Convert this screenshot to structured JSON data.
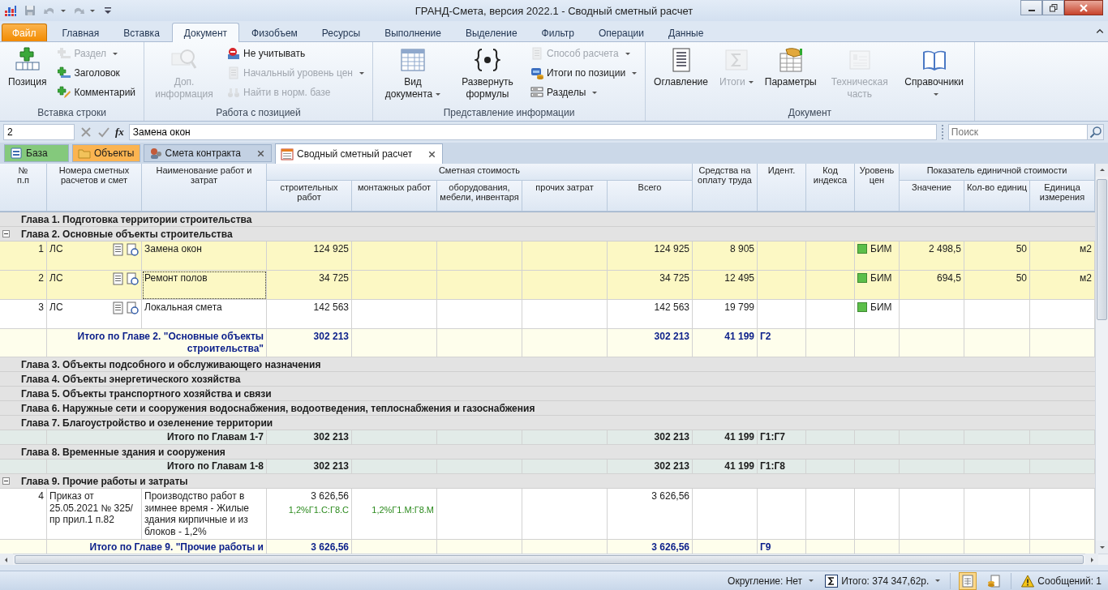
{
  "window": {
    "title": "ГРАНД-Смета, версия 2022.1 - Сводный сметный расчет"
  },
  "ribbon_tabs": [
    {
      "label": "Файл",
      "kind": "file",
      "selected": false
    },
    {
      "label": "Главная",
      "kind": "tab",
      "selected": false
    },
    {
      "label": "Вставка",
      "kind": "tab",
      "selected": false
    },
    {
      "label": "Документ",
      "kind": "tab",
      "selected": true
    },
    {
      "label": "Физобъем",
      "kind": "tab",
      "selected": false
    },
    {
      "label": "Ресурсы",
      "kind": "tab",
      "selected": false
    },
    {
      "label": "Выполнение",
      "kind": "tab",
      "selected": false
    },
    {
      "label": "Выделение",
      "kind": "tab",
      "selected": false
    },
    {
      "label": "Фильтр",
      "kind": "tab",
      "selected": false
    },
    {
      "label": "Операции",
      "kind": "tab",
      "selected": false
    },
    {
      "label": "Данные",
      "kind": "tab",
      "selected": false
    }
  ],
  "ribbon_groups": [
    {
      "title": "Вставка строки",
      "buttons": [
        {
          "label": "Позиция",
          "kind": "large",
          "disabled": false,
          "dropdown": false
        },
        {
          "label": "Раздел",
          "kind": "small",
          "disabled": true,
          "dropdown": true
        },
        {
          "label": "Заголовок",
          "kind": "small",
          "disabled": false,
          "dropdown": false
        },
        {
          "label": "Комментарий",
          "kind": "small",
          "disabled": false,
          "dropdown": false
        }
      ]
    },
    {
      "title": "Работа с позицией",
      "buttons": [
        {
          "label": "Доп. информация",
          "kind": "large",
          "disabled": true,
          "dropdown": false
        },
        {
          "label": "Не учитывать",
          "kind": "small",
          "disabled": false,
          "dropdown": false
        },
        {
          "label": "Начальный уровень цен",
          "kind": "small",
          "disabled": true,
          "dropdown": true
        },
        {
          "label": "Найти в норм. базе",
          "kind": "small",
          "disabled": true,
          "dropdown": false
        }
      ]
    },
    {
      "title": "Представление информации",
      "buttons": [
        {
          "label": "Вид документа",
          "kind": "large",
          "disabled": false,
          "dropdown": true
        },
        {
          "label": "Развернуть формулы",
          "kind": "large",
          "disabled": false,
          "dropdown": false
        },
        {
          "label": "Способ расчета",
          "kind": "small",
          "disabled": true,
          "dropdown": true
        },
        {
          "label": "Итоги по позиции",
          "kind": "small",
          "disabled": false,
          "dropdown": true
        },
        {
          "label": "Разделы",
          "kind": "small",
          "disabled": false,
          "dropdown": true
        }
      ]
    },
    {
      "title": "Документ",
      "buttons": [
        {
          "label": "Оглавление",
          "kind": "large",
          "disabled": false,
          "dropdown": false
        },
        {
          "label": "Итоги",
          "kind": "large",
          "disabled": true,
          "dropdown": true
        },
        {
          "label": "Параметры",
          "kind": "large",
          "disabled": false,
          "dropdown": false
        },
        {
          "label": "Техническая часть",
          "kind": "large",
          "disabled": true,
          "dropdown": false
        },
        {
          "label": "Справочники",
          "kind": "large",
          "disabled": false,
          "dropdown": true
        }
      ]
    }
  ],
  "formula_bar": {
    "cell": "2",
    "fx": "fx",
    "value": "Замена окон",
    "search": {
      "placeholder": "Поиск"
    }
  },
  "doc_tabs": [
    {
      "label": "База",
      "color": "#84c97c",
      "closable": false,
      "selected": false
    },
    {
      "label": "Объекты",
      "color": "#fbb451",
      "closable": false,
      "selected": false
    },
    {
      "label": "Смета контракта",
      "closable": true,
      "selected": false
    },
    {
      "label": "Сводный сметный расчет",
      "closable": true,
      "selected": true
    }
  ],
  "table": {
    "columns": [
      {
        "label": "№\nп.п"
      },
      {
        "label": "Номера сметных расчетов и смет"
      },
      {
        "label": "Наименование работ и затрат"
      },
      {
        "label": "Сметная стоимость",
        "children": [
          {
            "label": "строительных работ"
          },
          {
            "label": "монтажных работ"
          },
          {
            "label": "оборудования, мебели, инвентаря"
          },
          {
            "label": "прочих затрат"
          },
          {
            "label": "Всего"
          }
        ]
      },
      {
        "label": "Средства на оплату труда"
      },
      {
        "label": "Идент."
      },
      {
        "label": "Код индекса"
      },
      {
        "label": "Уровень цен"
      },
      {
        "label": "Показатель единичной стоимости",
        "children": [
          {
            "label": "Значение"
          },
          {
            "label": "Кол-во единиц"
          },
          {
            "label": "Единица измерения"
          }
        ]
      }
    ],
    "rows": [
      {
        "kind": "chapter",
        "title": "Глава 1. Подготовка территории строительства"
      },
      {
        "kind": "chapter",
        "title": "Глава 2. Основные объекты строительства",
        "expanded": true
      },
      {
        "kind": "item",
        "number": "1",
        "document": "ЛС",
        "linked": true,
        "name": "Замена окон",
        "selected": true,
        "focused": false,
        "construction": "124 925",
        "total": "124 925",
        "labor": "8 905",
        "price_level": {
          "label": "БИМ",
          "color": "#5cbf4a"
        },
        "unit_value": "2 498,5",
        "quantity": "50",
        "unit": "м2"
      },
      {
        "kind": "item",
        "number": "2",
        "document": "ЛС",
        "linked": true,
        "name": "Ремонт полов",
        "selected": true,
        "focused": true,
        "construction": "34 725",
        "total": "34 725",
        "labor": "12 495",
        "price_level": {
          "label": "БИМ",
          "color": "#5cbf4a"
        },
        "unit_value": "694,5",
        "quantity": "50",
        "unit": "м2"
      },
      {
        "kind": "item",
        "number": "3",
        "document": "ЛС",
        "linked": true,
        "name": "Локальная смета",
        "selected": false,
        "focused": false,
        "construction": "142 563",
        "total": "142 563",
        "labor": "19 799",
        "price_level": {
          "label": "БИМ",
          "color": "#5cbf4a"
        }
      },
      {
        "kind": "total",
        "label": "Итого по Главе 2. \"Основные объекты строительства\"",
        "construction": "302 213",
        "total": "302 213",
        "labor": "41 199",
        "ident": "Г2"
      },
      {
        "kind": "chapter",
        "title": "Глава 3. Объекты подсобного и обслуживающего назначения"
      },
      {
        "kind": "chapter",
        "title": "Глава 4. Объекты энергетического хозяйства"
      },
      {
        "kind": "chapter",
        "title": "Глава 5. Объекты транспортного хозяйства и связи"
      },
      {
        "kind": "chapter",
        "title": "Глава 6. Наружные сети и сооружения водоснабжения, водоотведения, теплоснабжения и газоснабжения"
      },
      {
        "kind": "chapter",
        "title": "Глава 7. Благоустройство и озеленение территории"
      },
      {
        "kind": "grand_total",
        "label": "Итого по Главам 1-7",
        "construction": "302 213",
        "total": "302 213",
        "labor": "41 199",
        "ident": "Г1:Г7"
      },
      {
        "kind": "chapter",
        "title": "Глава 8. Временные здания и сооружения"
      },
      {
        "kind": "grand_total",
        "label": "Итого по Главам 1-8",
        "construction": "302 213",
        "total": "302 213",
        "labor": "41 199",
        "ident": "Г1:Г8"
      },
      {
        "kind": "chapter",
        "title": "Глава 9. Прочие работы и затраты",
        "expanded": true
      },
      {
        "kind": "item",
        "number": "4",
        "document": "Приказ от 25.05.2021 № 325/пр прил.1 п.82",
        "linked": false,
        "name": "Производство работ в зимнее время - Жилые здания кирпичные и из блоков - 1,2%",
        "selected": false,
        "focused": false,
        "construction": "3 626,56",
        "construction_formula": "1,2%Г1.С:Г8.С",
        "installation_formula": "1,2%Г1.М:Г8.М",
        "total": "3 626,56"
      },
      {
        "kind": "total_cut",
        "label": "Итого по Главе 9. \"Прочие работы и",
        "construction": "3 626,56",
        "total": "3 626,56",
        "ident": "Г9"
      }
    ]
  },
  "status_bar": {
    "rounding": "Округление: Нет",
    "sum": "Итого: 374 347,62р.",
    "views": [
      {
        "selected": true
      },
      {
        "selected": false
      }
    ],
    "messages": "Сообщений: 1"
  }
}
